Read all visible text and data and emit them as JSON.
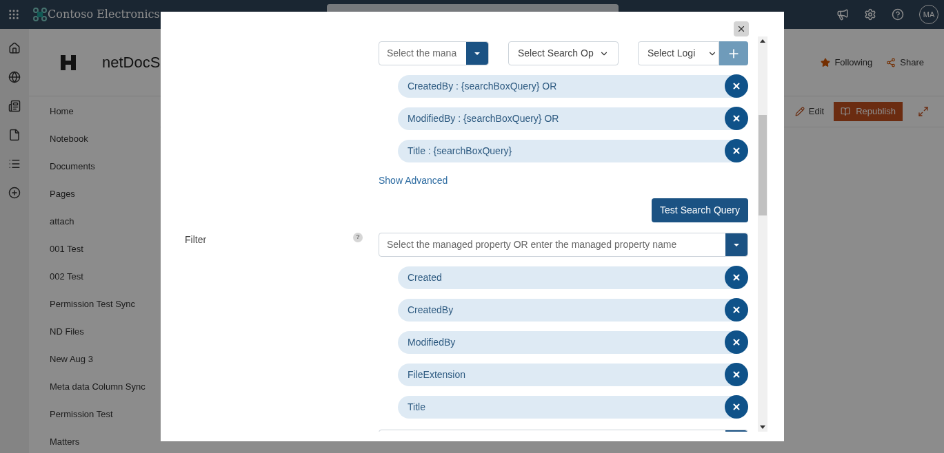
{
  "top_bar": {
    "brand": "Contoso Electronics",
    "avatar": "MA"
  },
  "site": {
    "title": "netDocS",
    "follow": "Following",
    "share": "Share"
  },
  "toolbar": {
    "edit": "Edit",
    "republish": "Republish"
  },
  "nav": {
    "items": [
      {
        "label": "Home"
      },
      {
        "label": "Notebook"
      },
      {
        "label": "Documents"
      },
      {
        "label": "Pages"
      },
      {
        "label": "attach"
      },
      {
        "label": "001 Test"
      },
      {
        "label": "002 Test"
      },
      {
        "label": "Permission Test Sync"
      },
      {
        "label": "ND Files"
      },
      {
        "label": "New Aug 3"
      },
      {
        "label": "Meta data Column Sync"
      },
      {
        "label": "Permission Test"
      },
      {
        "label": "Matters"
      }
    ]
  },
  "dialog": {
    "query": {
      "property_placeholder": "Select the mana",
      "operator": "Select Search Op",
      "logic": "Select Logi",
      "conditions": [
        {
          "text": "CreatedBy : {searchBoxQuery} OR"
        },
        {
          "text": "ModifiedBy : {searchBoxQuery} OR"
        },
        {
          "text": "Title : {searchBoxQuery}"
        }
      ],
      "advanced_link": "Show Advanced",
      "test_button": "Test Search Query"
    },
    "filter": {
      "label": "Filter",
      "help": "?",
      "placeholder": "Select the managed property OR enter the managed property name",
      "properties": [
        {
          "text": "Created"
        },
        {
          "text": "CreatedBy"
        },
        {
          "text": "ModifiedBy"
        },
        {
          "text": "FileExtension"
        },
        {
          "text": "Title"
        }
      ]
    }
  }
}
